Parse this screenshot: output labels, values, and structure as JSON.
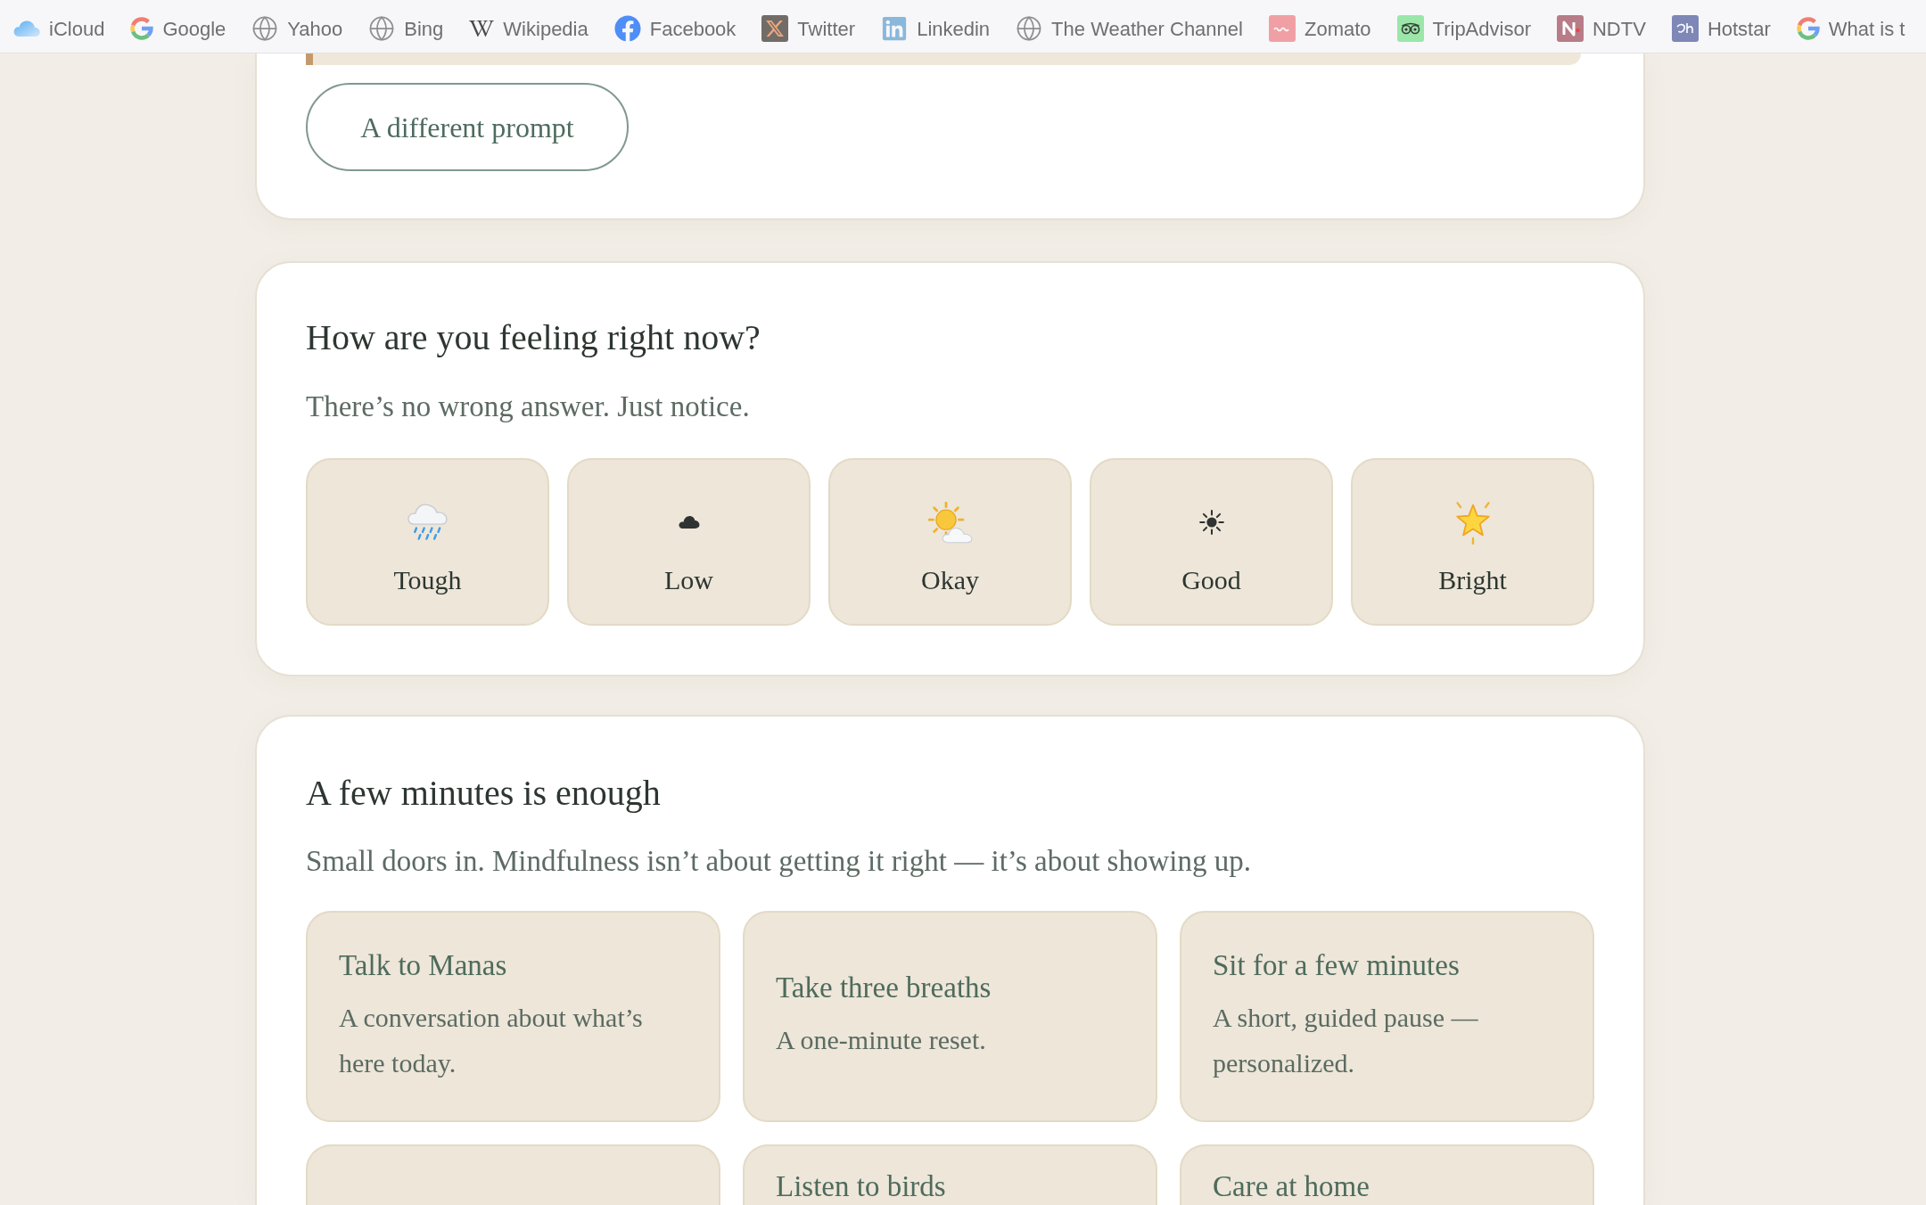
{
  "bookmarks": [
    {
      "label": "iCloud",
      "kind": "icloud"
    },
    {
      "label": "Google",
      "kind": "google"
    },
    {
      "label": "Yahoo",
      "kind": "globe"
    },
    {
      "label": "Bing",
      "kind": "globe"
    },
    {
      "label": "Wikipedia",
      "kind": "wikipedia"
    },
    {
      "label": "Facebook",
      "kind": "facebook"
    },
    {
      "label": "Twitter",
      "kind": "x"
    },
    {
      "label": "Linkedin",
      "kind": "linkedin"
    },
    {
      "label": "The Weather Channel",
      "kind": "globe"
    },
    {
      "label": "Zomato",
      "kind": "zomato"
    },
    {
      "label": "TripAdvisor",
      "kind": "tripadvisor"
    },
    {
      "label": "NDTV",
      "kind": "ndtv"
    },
    {
      "label": "Hotstar",
      "kind": "hotstar"
    },
    {
      "label": "What is t",
      "kind": "google"
    }
  ],
  "prompt_card": {
    "button": "A different prompt"
  },
  "mood_check": {
    "title": "How are you feeling right now?",
    "subtitle": "There’s no wrong answer. Just notice.",
    "moods": [
      {
        "label": "Tough",
        "kind": "rain",
        "selected": false
      },
      {
        "label": "Low",
        "kind": "cloud",
        "selected": false
      },
      {
        "label": "Okay",
        "kind": "suncloud",
        "selected": false
      },
      {
        "label": "Good",
        "kind": "sun",
        "selected": false
      },
      {
        "label": "Bright",
        "kind": "star",
        "selected": false
      }
    ]
  },
  "practices": {
    "title": "A few minutes is enough",
    "subtitle": "Small doors in. Mindfulness isn’t about getting it right — it’s about showing up.",
    "cards": [
      {
        "kind": "full",
        "title": "Talk to Manas",
        "description": "A conversation about what’s here today."
      },
      {
        "kind": "full",
        "title": "Take three breaths",
        "description": "A one-minute reset."
      },
      {
        "kind": "full",
        "title": "Sit for a few minutes",
        "description": "A short, guided pause — personalized."
      },
      {
        "kind": "cut"
      },
      {
        "kind": "cut",
        "title": "Listen to birds"
      },
      {
        "kind": "cut",
        "title": "Care at home"
      }
    ]
  }
}
